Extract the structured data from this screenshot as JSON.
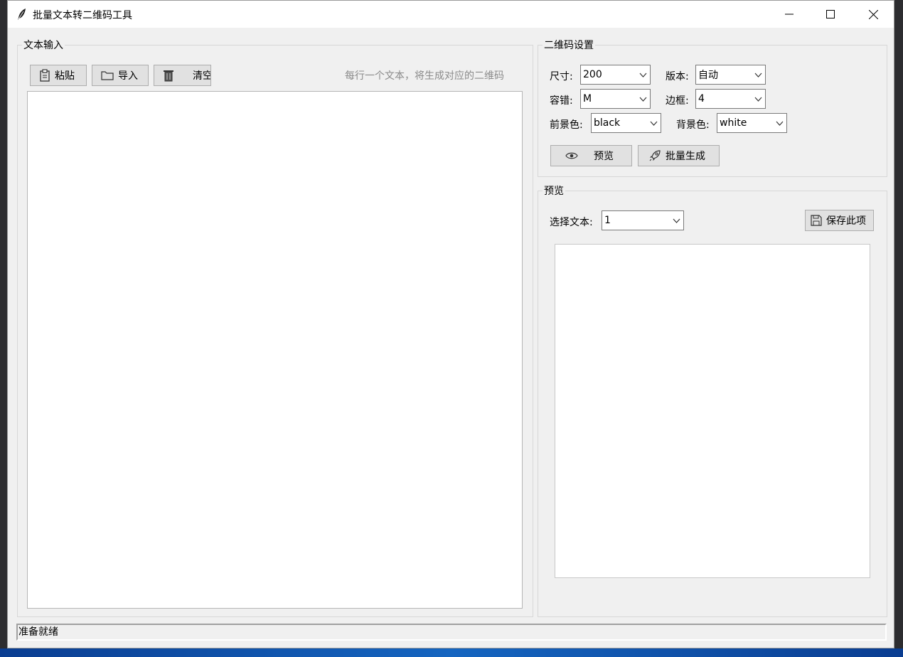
{
  "window": {
    "title": "批量文本转二维码工具"
  },
  "text_input": {
    "group_title": "文本输入",
    "paste_label": "粘贴",
    "import_label": "导入",
    "clear_label": "清空",
    "hint": "每行一个文本，将生成对应的二维码",
    "content": ""
  },
  "qr_settings": {
    "group_title": "二维码设置",
    "size_label": "尺寸:",
    "size_value": "200",
    "version_label": "版本:",
    "version_value": "自动",
    "error_label": "容错:",
    "error_value": "M",
    "border_label": "边框:",
    "border_value": "4",
    "fg_label": "前景色:",
    "fg_value": "black",
    "bg_label": "背景色:",
    "bg_value": "white",
    "preview_button": "预览",
    "batch_button": "批量生成"
  },
  "preview": {
    "group_title": "预览",
    "select_label": "选择文本:",
    "select_value": "1",
    "save_button": "保存此项"
  },
  "status": {
    "text": "准备就绪"
  }
}
